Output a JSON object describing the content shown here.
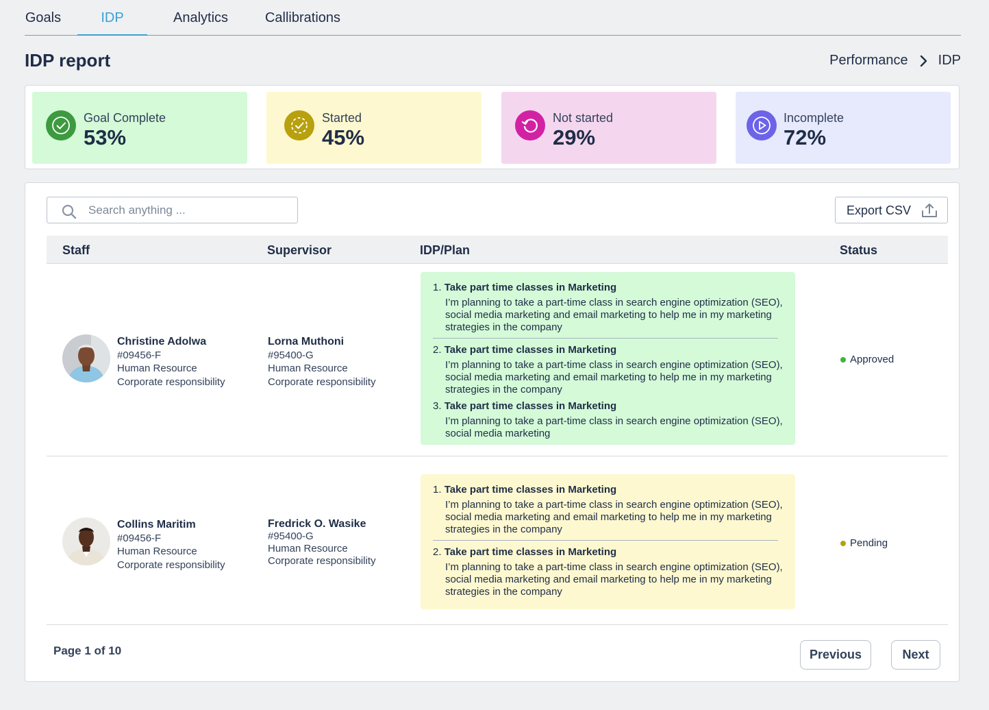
{
  "tabs": [
    {
      "label": "Goals"
    },
    {
      "label": "IDP"
    },
    {
      "label": "Analytics"
    },
    {
      "label": "Callibrations"
    }
  ],
  "page_title": "IDP report",
  "breadcrumb": {
    "parent": "Performance",
    "current": "IDP"
  },
  "stats": [
    {
      "label": "Goal Complete",
      "value": "53%",
      "icon": "check-circle-icon",
      "bg": "#d4fad8",
      "icon_bg": "#3d9a3f"
    },
    {
      "label": "Started",
      "value": "45%",
      "icon": "dashed-check-icon",
      "bg": "#fdf8cf",
      "icon_bg": "#b8a00e"
    },
    {
      "label": "Not started",
      "value": "29%",
      "icon": "refresh-icon",
      "bg": "#f4d7ee",
      "icon_bg": "#d321a4"
    },
    {
      "label": "Incomplete",
      "value": "72%",
      "icon": "play-circle-icon",
      "bg": "#e7eafd",
      "icon_bg": "#6c63e8"
    }
  ],
  "search": {
    "placeholder": "Search anything ..."
  },
  "export_label": "Export CSV",
  "columns": {
    "staff": "Staff",
    "supervisor": "Supervisor",
    "plan": "IDP/Plan",
    "status": "Status"
  },
  "rows": [
    {
      "staff": {
        "name": "Christine Adolwa",
        "id": "#09456-F",
        "dept": "Human Resource",
        "unit": "Corporate responsibility"
      },
      "supervisor": {
        "name": "Lorna Muthoni",
        "id": "#95400-G",
        "dept": "Human Resource",
        "unit": "Corporate responsibility"
      },
      "plan_color": "#d4fad8",
      "plan": [
        {
          "num": "1.",
          "title": "Take part time classes in Marketing",
          "desc": "I’m planning to take a part-time class in search engine optimization (SEO), social media marketing and email marketing to help me in my marketing strategies in the company"
        },
        {
          "num": "2.",
          "title": "Take part time classes in Marketing",
          "desc": "I’m planning to take a part-time class in search engine optimization (SEO), social media marketing and email marketing to help me in my marketing strategies in the company"
        },
        {
          "num": "3.",
          "title": "Take part time classes in Marketing",
          "desc": "I’m planning to take a part-time class in search engine optimization (SEO), social media marketing"
        }
      ],
      "status": "Approved",
      "status_color": "#3fb43b"
    },
    {
      "staff": {
        "name": "Collins Maritim",
        "id": "#09456-F",
        "dept": "Human Resource",
        "unit": "Corporate responsibility"
      },
      "supervisor": {
        "name": "Fredrick O. Wasike",
        "id": "#95400-G",
        "dept": "Human Resource",
        "unit": "Corporate responsibility"
      },
      "plan_color": "#fdf8cf",
      "plan": [
        {
          "num": "1.",
          "title": "Take part time classes in Marketing",
          "desc": "I’m planning to take a part-time class in search engine optimization (SEO), social media marketing and email marketing to help me in my marketing strategies in the company"
        },
        {
          "num": "2.",
          "title": "Take part time classes in Marketing",
          "desc": "I’m planning to take a part-time class in search engine optimization (SEO), social media marketing and email marketing to help me in my marketing strategies in the company"
        }
      ],
      "status": "Pending",
      "status_color": "#b8a00e"
    }
  ],
  "pagination": {
    "info": "Page 1 of 10",
    "previous": "Previous",
    "next": "Next"
  }
}
